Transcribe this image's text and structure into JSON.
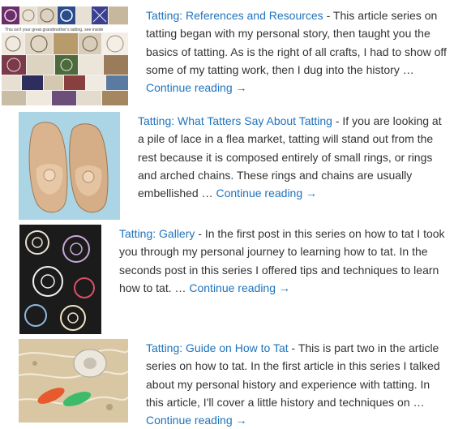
{
  "posts": [
    {
      "title": "Tatting: References and Resources",
      "separator": " - ",
      "excerpt": "This article series on tatting began with my personal story, then taught you the basics of tatting. As is the right of all crafts, I had to show off some of my tatting work, then I dug into the history",
      "ellipsis": " … ",
      "continue": "Continue reading →",
      "thumb_caption": "This isn't your great grandmother's tatting, see inside"
    },
    {
      "title": "Tatting: What Tatters Say About Tatting",
      "separator": " - ",
      "excerpt": "If you are looking at a pile of lace in a flea market, tatting will stand out from the rest because it is composed entirely of small rings, or rings and arched chains. These rings and chains are usually embellished",
      "ellipsis": " … ",
      "continue": "Continue reading →"
    },
    {
      "title": "Tatting: Gallery",
      "separator": " - ",
      "excerpt": "In the first post in this series on how to tat I took you through my personal journey to learning how to tat. In the seconds post in this series I offered tips and techniques to learn how to tat.",
      "ellipsis": " … ",
      "continue": "Continue reading →"
    },
    {
      "title": "Tatting: Guide on How to Tat",
      "separator": " - ",
      "excerpt": "This is part two in the article series on how to tat. In the first article in this series I talked about my personal history and experience with tatting. In this article, I'll cover a little history and techniques on",
      "ellipsis": " … ",
      "continue": "Continue reading →"
    }
  ]
}
